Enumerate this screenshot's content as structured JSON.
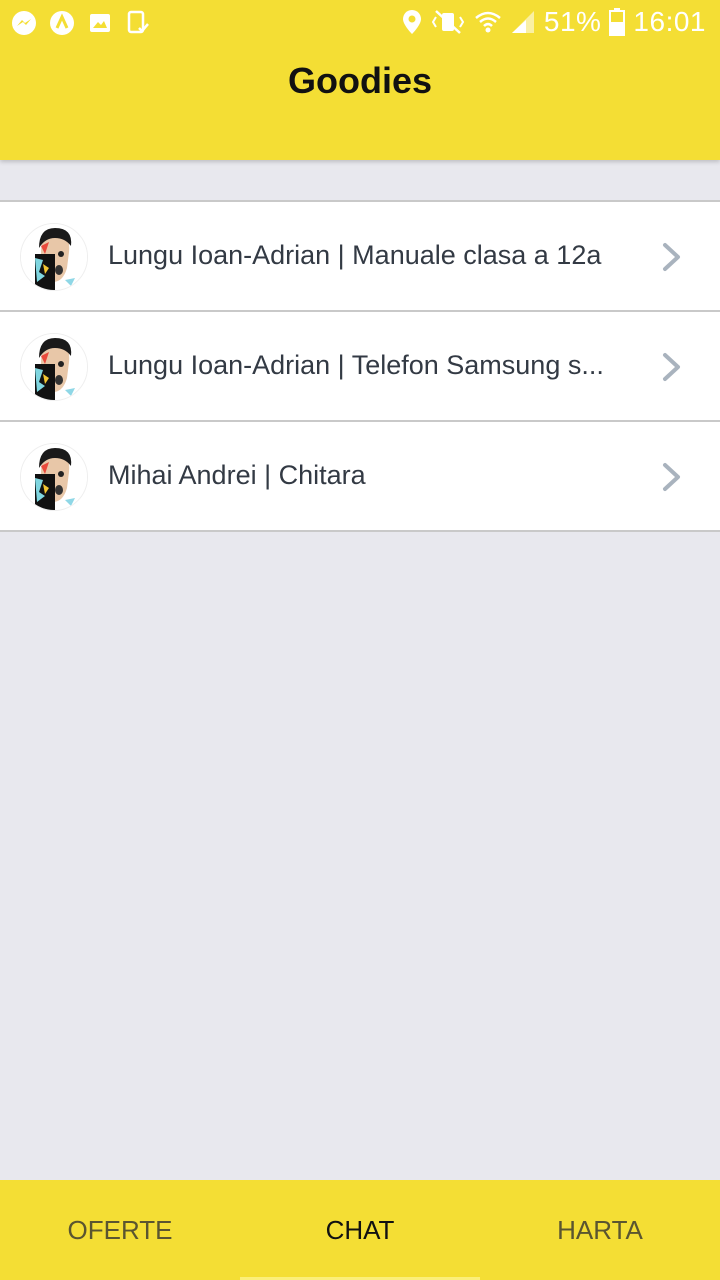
{
  "status_bar": {
    "icons_left": [
      "messenger-icon",
      "app-notification-icon",
      "gallery-icon",
      "download-complete-icon"
    ],
    "icons_right": [
      "location-icon",
      "vibrate-mute-icon",
      "wifi-icon",
      "signal-icon"
    ],
    "battery": "51%",
    "time": "16:01"
  },
  "header": {
    "title": "Goodies",
    "background": "#f4de34"
  },
  "chats": [
    {
      "title": "Lungu Ioan-Adrian | Manuale clasa a 12a",
      "avatar": "user-avatar",
      "chevron": "chevron-right-icon"
    },
    {
      "title": "Lungu Ioan-Adrian | Telefon Samsung s...",
      "avatar": "user-avatar",
      "chevron": "chevron-right-icon"
    },
    {
      "title": "Mihai Andrei | Chitara",
      "avatar": "user-avatar",
      "chevron": "chevron-right-icon"
    }
  ],
  "bottom_nav": {
    "tabs": [
      {
        "label": "OFERTE",
        "active": false
      },
      {
        "label": "CHAT",
        "active": true
      },
      {
        "label": "HARTA",
        "active": false
      }
    ]
  },
  "colors": {
    "accent": "#f4de34",
    "list_background": "#ffffff",
    "page_background": "#e8e8ee",
    "chevron": "#a9b3be"
  }
}
